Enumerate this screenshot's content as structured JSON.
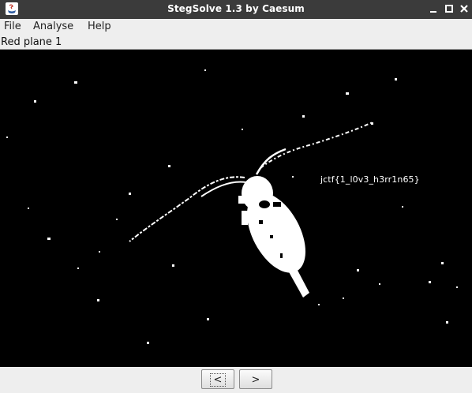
{
  "window": {
    "title": "StegSolve 1.3 by Caesum"
  },
  "menu": {
    "items": [
      "File",
      "Analyse",
      "Help"
    ]
  },
  "view": {
    "plane_label": "Red plane 1",
    "overlay_text": "jctf{1_l0v3_h3rr1n65}"
  },
  "nav": {
    "prev_label": "<",
    "next_label": ">"
  },
  "colors": {
    "titlebar": "#3b3b3b",
    "viewport": "#000000",
    "foreground": "#ffffff"
  },
  "icons": {
    "app": "java-app-icon",
    "minimize": "minimize-icon",
    "maximize": "maximize-icon",
    "close": "close-icon"
  }
}
